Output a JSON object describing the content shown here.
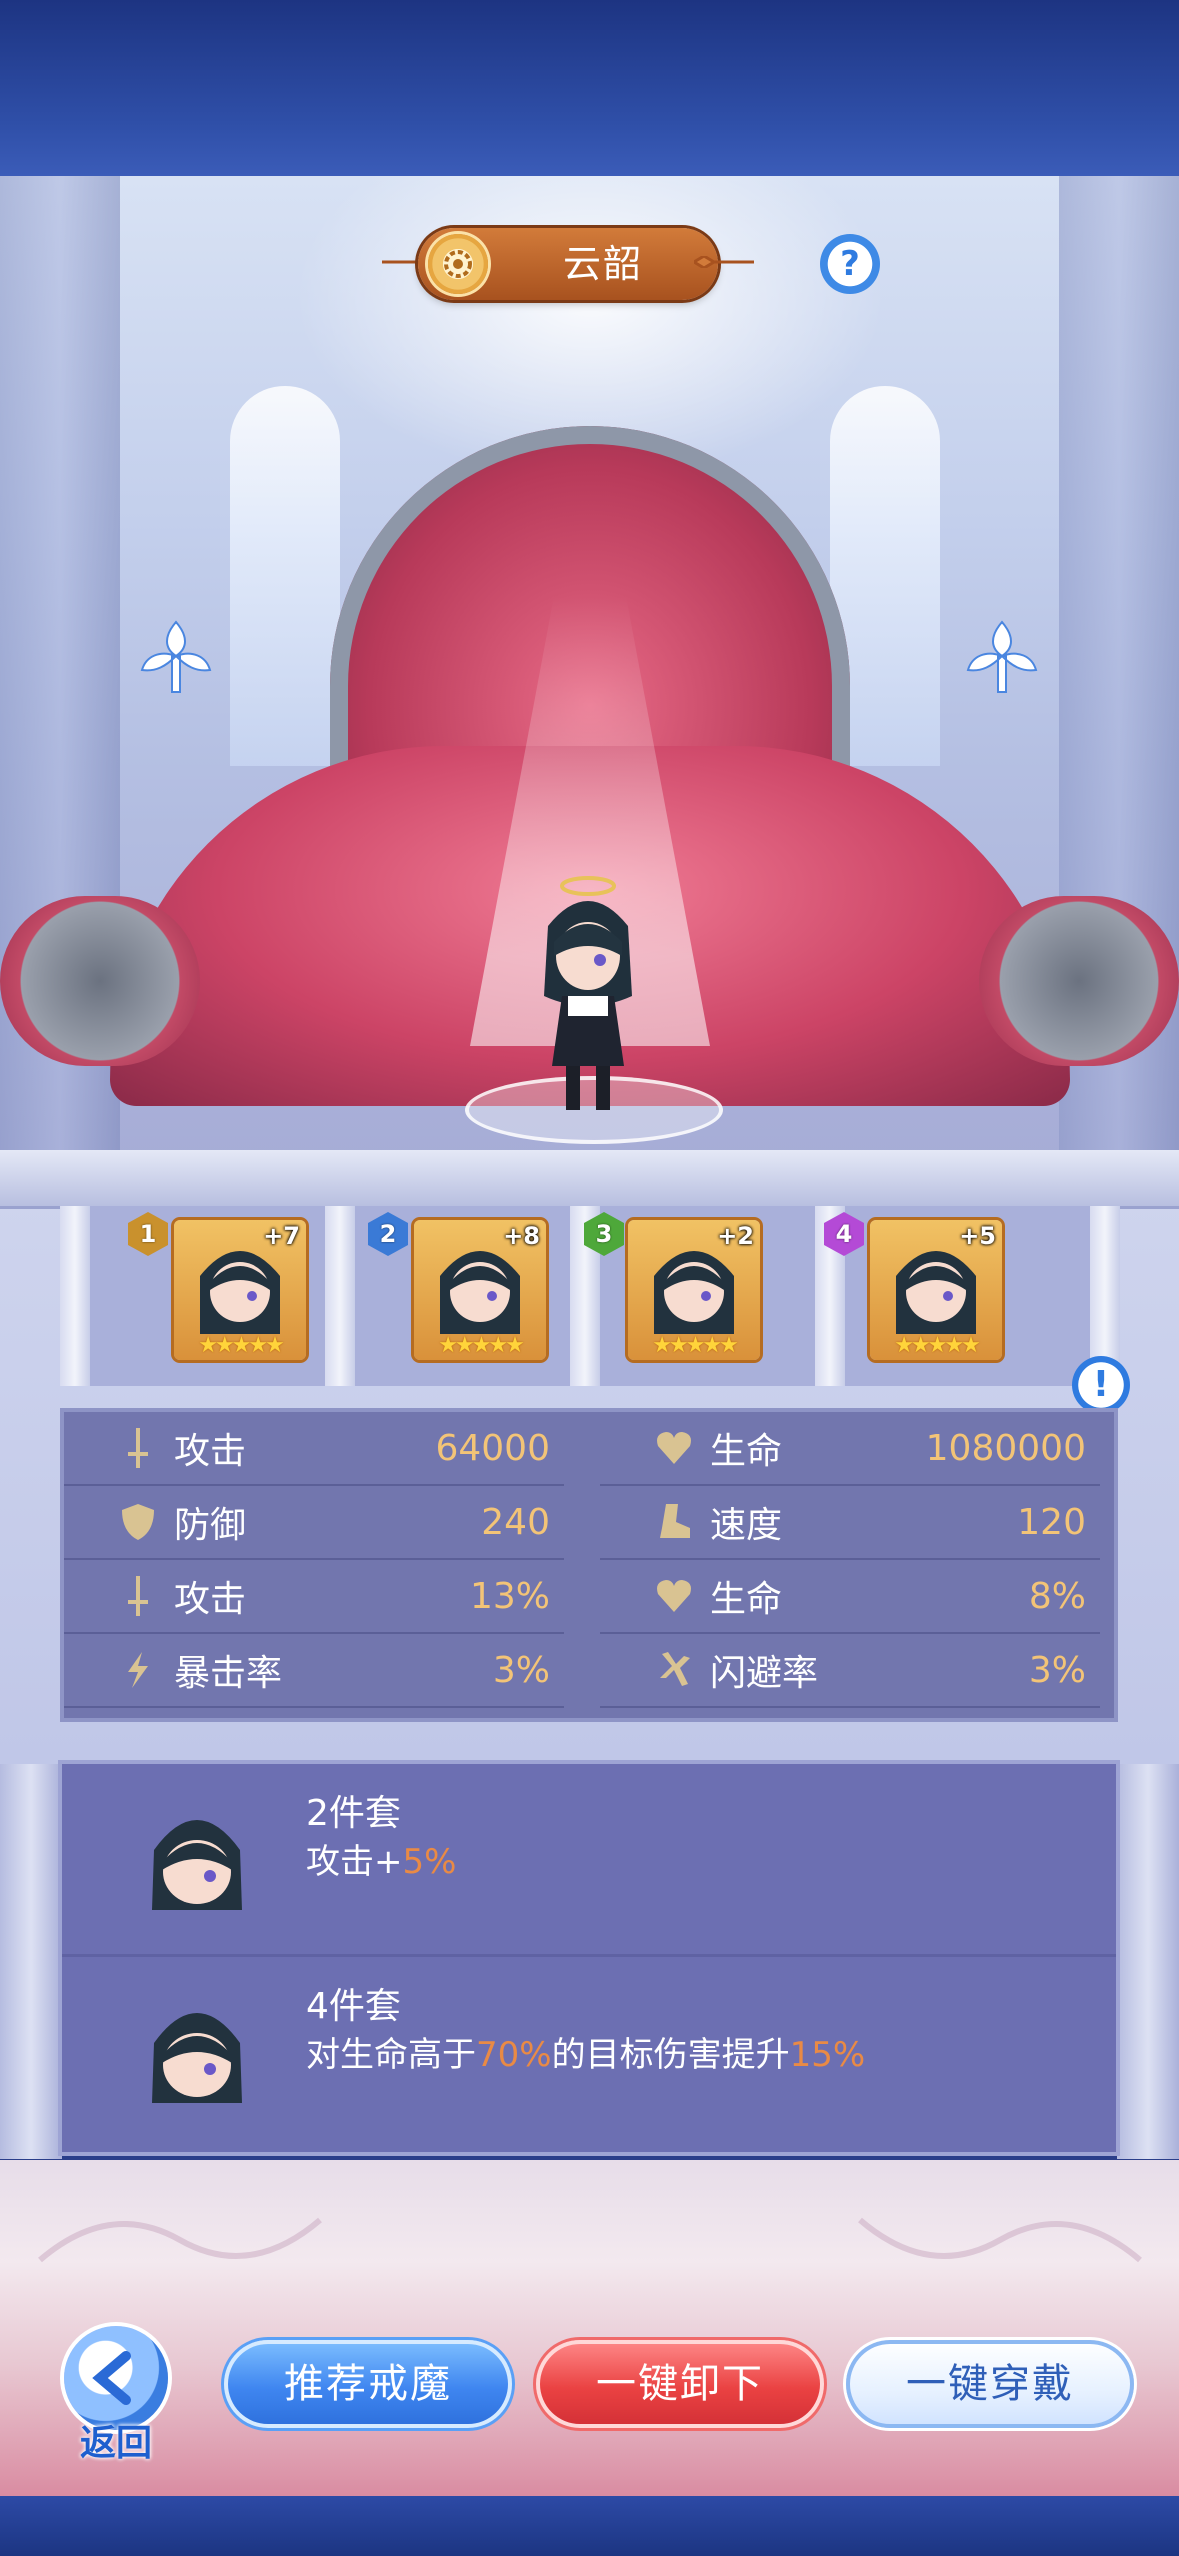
{
  "header": {
    "title": "云韶",
    "help_icon": "?"
  },
  "slots": [
    {
      "index": "1",
      "plus": "+7",
      "stars": "★★★★★",
      "badge_color": "#c9912d"
    },
    {
      "index": "2",
      "plus": "+8",
      "stars": "★★★★★",
      "badge_color": "#3a7ad6"
    },
    {
      "index": "3",
      "plus": "+2",
      "stars": "★★★★★",
      "badge_color": "#4ea83a"
    },
    {
      "index": "4",
      "plus": "+5",
      "stars": "★★★★★",
      "badge_color": "#b44ad6"
    }
  ],
  "info_icon": "!",
  "stats": {
    "left": [
      {
        "icon": "sword-icon",
        "label": "攻击",
        "value": "64000"
      },
      {
        "icon": "shield-icon",
        "label": "防御",
        "value": "240"
      },
      {
        "icon": "sword-icon",
        "label": "攻击",
        "value": "13%"
      },
      {
        "icon": "crit-icon",
        "label": "暴击率",
        "value": "3%"
      }
    ],
    "right": [
      {
        "icon": "heart-icon",
        "label": "生命",
        "value": "1080000"
      },
      {
        "icon": "boot-icon",
        "label": "速度",
        "value": "120"
      },
      {
        "icon": "heart-icon",
        "label": "生命",
        "value": "8%"
      },
      {
        "icon": "dodge-icon",
        "label": "闪避率",
        "value": "3%"
      }
    ]
  },
  "sets": [
    {
      "title": "2件套",
      "desc_1": "攻击+",
      "desc_hl_1": "5%",
      "desc_2": "",
      "desc_hl_2": ""
    },
    {
      "title": "4件套",
      "desc_1": "对生命高于",
      "desc_hl_1": "70%",
      "desc_2": "的目标伤害提升",
      "desc_hl_2": "15%"
    }
  ],
  "footer": {
    "back_label": "返回",
    "recommend_label": "推荐戒魔",
    "unequip_label": "一键卸下",
    "equip_label": "一键穿戴"
  },
  "colors": {
    "stat_value": "#f3c477",
    "highlight": "#e98a45"
  }
}
